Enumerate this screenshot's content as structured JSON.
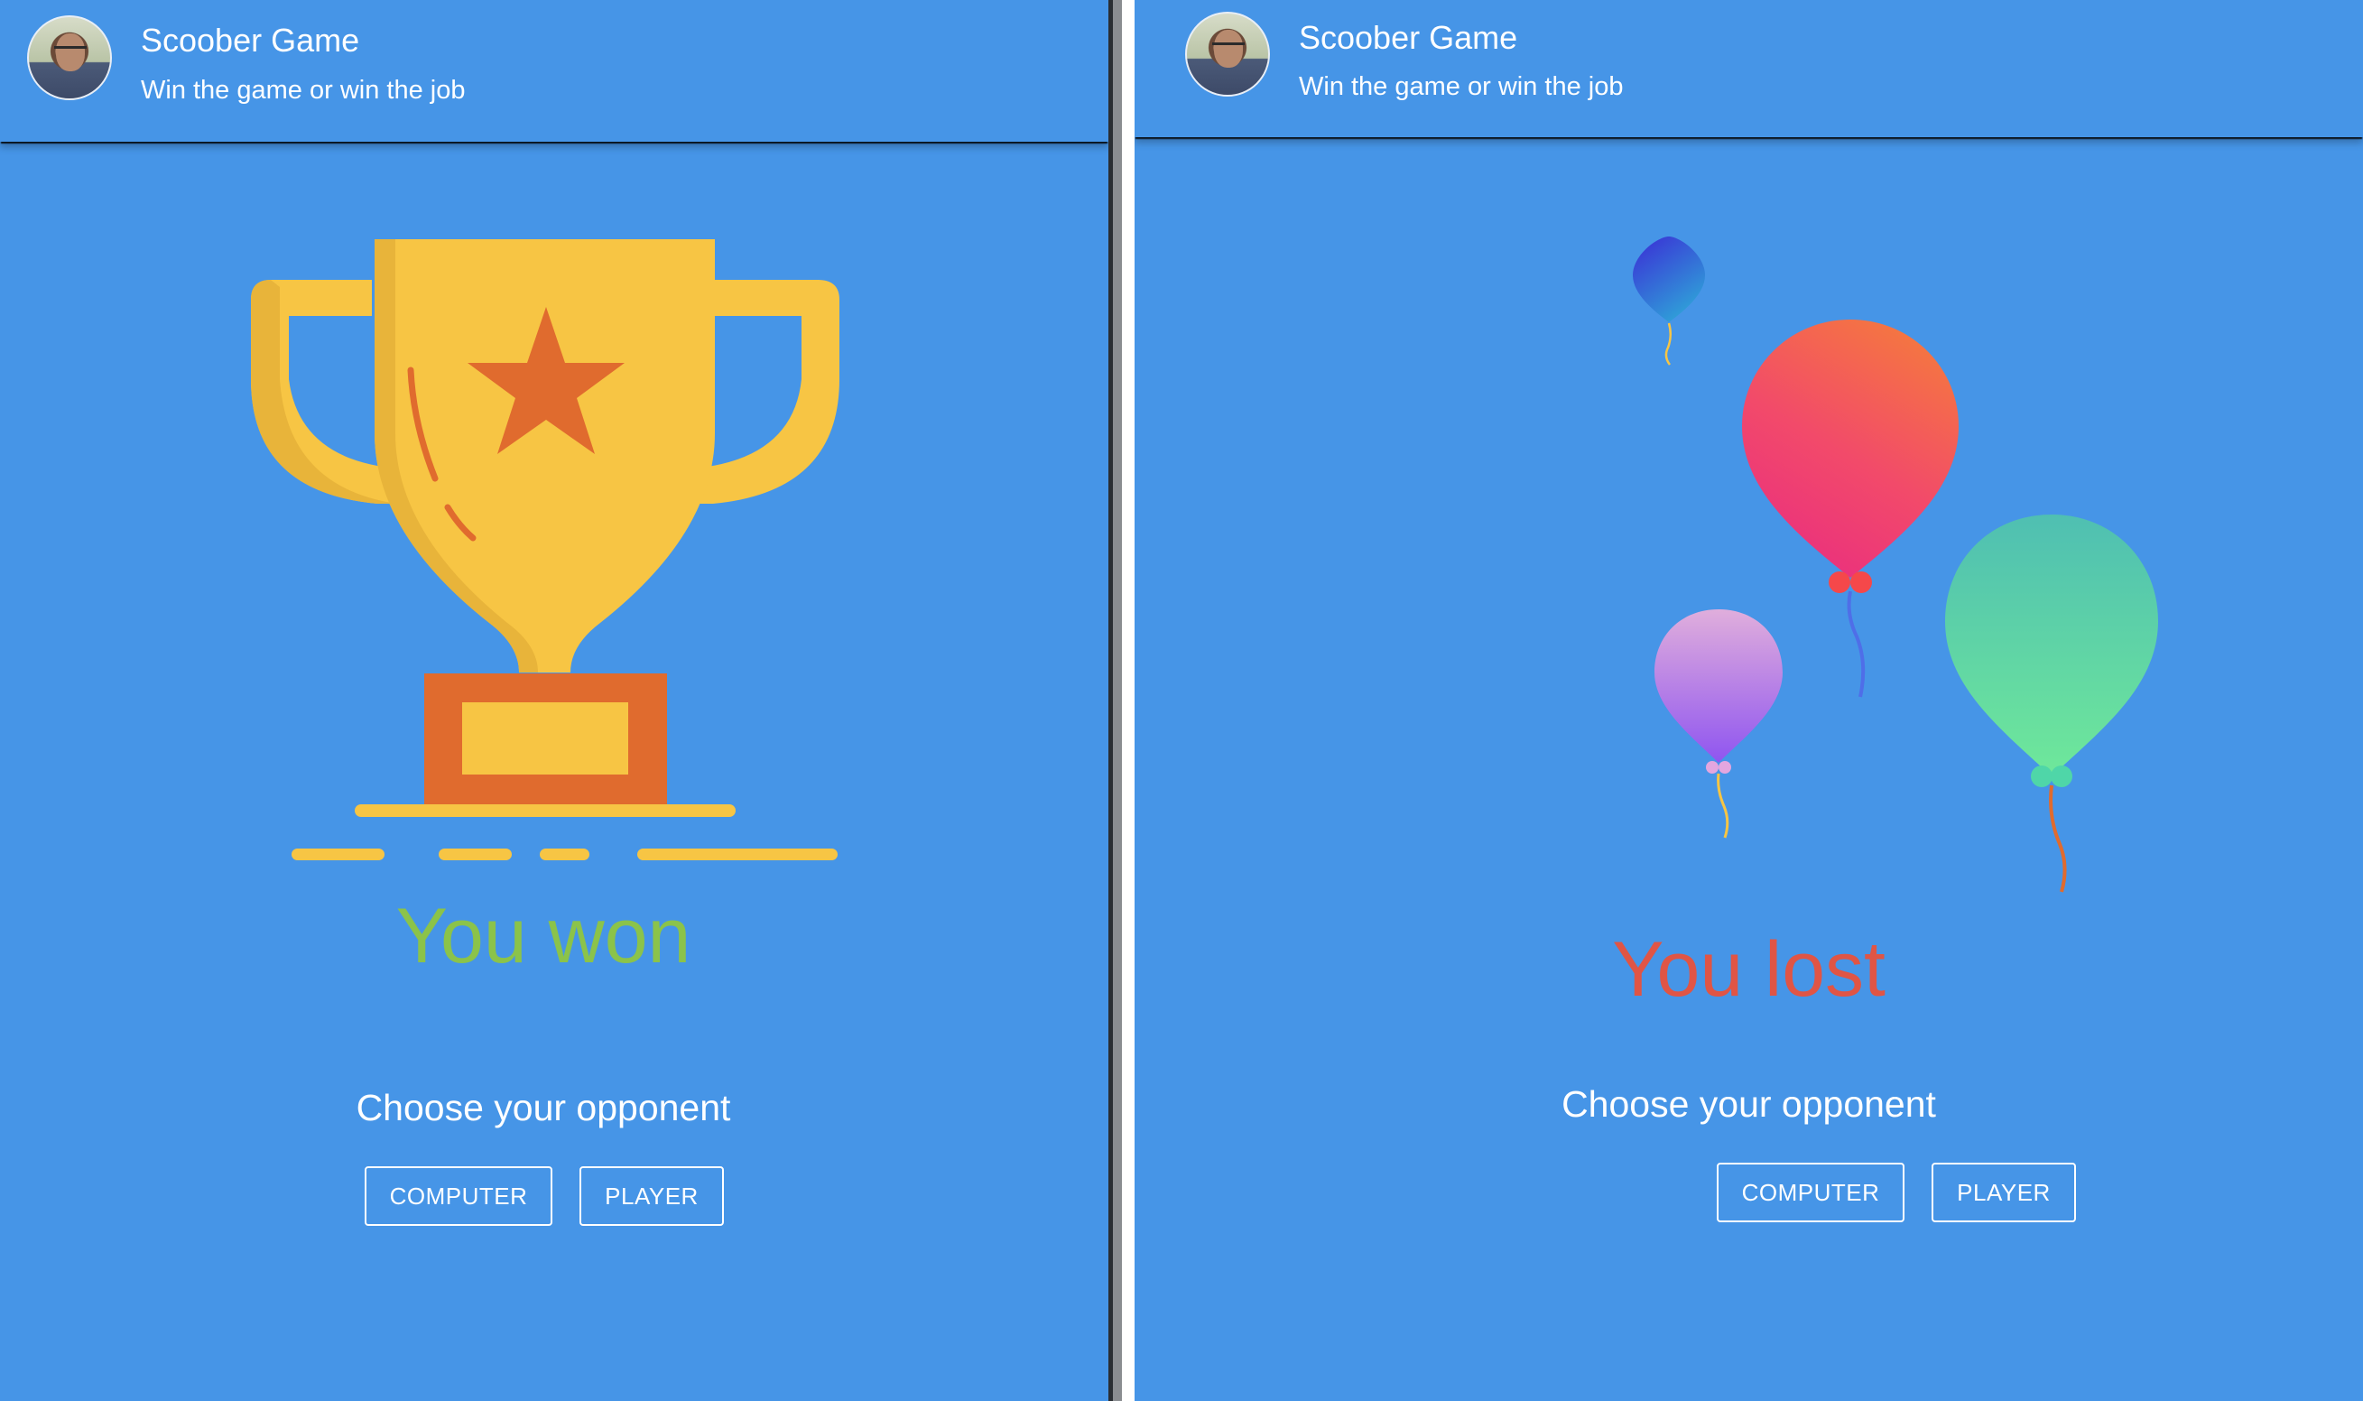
{
  "panels": [
    {
      "header": {
        "title": "Scoober Game",
        "subtitle": "Win the game or win the job",
        "avatar_icon": "user-avatar"
      },
      "result_text": "You won",
      "result_color": "#8bc34a",
      "illustration_icon": "trophy-icon",
      "choose_label": "Choose your opponent",
      "buttons": {
        "computer": "COMPUTER",
        "player": "PLAYER"
      }
    },
    {
      "header": {
        "title": "Scoober Game",
        "subtitle": "Win the game or win the job",
        "avatar_icon": "user-avatar"
      },
      "result_text": "You lost",
      "result_color": "#e05545",
      "illustration_icon": "balloons-icon",
      "choose_label": "Choose your opponent",
      "buttons": {
        "computer": "COMPUTER",
        "player": "PLAYER"
      }
    }
  ],
  "colors": {
    "background": "#4695e7",
    "trophy_gold": "#f7c544",
    "trophy_orange": "#e06b2e",
    "text": "#ffffff"
  }
}
